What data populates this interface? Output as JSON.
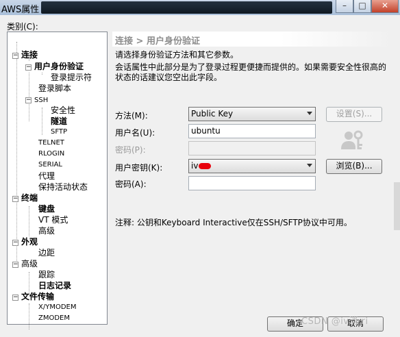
{
  "window": {
    "title": "AWS属性",
    "min_label": "–",
    "max_label": "□",
    "close_label": "✕"
  },
  "category_label": "类别(C):",
  "tree": {
    "items": [
      {
        "label": "连接",
        "bold": true,
        "expander": "−"
      },
      {
        "label": "用户身份验证",
        "bold": true,
        "expander": "−"
      },
      {
        "label": "登录提示符"
      },
      {
        "label": "登录脚本"
      },
      {
        "label": "SSH",
        "expander": "−"
      },
      {
        "label": "安全性"
      },
      {
        "label": "隧道",
        "bold": true
      },
      {
        "label": "SFTP"
      },
      {
        "label": "TELNET"
      },
      {
        "label": "RLOGIN"
      },
      {
        "label": "SERIAL"
      },
      {
        "label": "代理"
      },
      {
        "label": "保持活动状态"
      },
      {
        "label": "终端",
        "bold": true,
        "expander": "−"
      },
      {
        "label": "键盘",
        "bold": true
      },
      {
        "label": "VT 模式"
      },
      {
        "label": "高级"
      },
      {
        "label": "外观",
        "bold": true,
        "expander": "−"
      },
      {
        "label": "边距"
      },
      {
        "label": "高级",
        "expander": "−"
      },
      {
        "label": "跟踪"
      },
      {
        "label": "日志记录",
        "bold": true
      },
      {
        "label": "文件传输",
        "bold": true,
        "expander": "−"
      },
      {
        "label": "X/YMODEM"
      },
      {
        "label": "ZMODEM"
      }
    ]
  },
  "panel": {
    "breadcrumb": "连接 > 用户身份验证",
    "description": "请选择身份验证方法和其它参数。",
    "description2": "会话属性中此部分是为了登录过程更便捷而提供的。如果需要安全性很高的状态的话建议您空出此字段。"
  },
  "form": {
    "method_label": "方法(M):",
    "method_value": "Public Key",
    "settings_button": "设置(S)...",
    "username_label": "用户名(U):",
    "username_value": "ubuntu",
    "password_label": "密码(P):",
    "userkey_label": "用户密钥(K):",
    "userkey_value": "iv",
    "browse_button": "浏览(B)...",
    "passphrase_label": "密码(A):"
  },
  "note": "注释: 公钥和Keyboard Interactive仅在SSH/SFTP协议中可用。",
  "footer": {
    "ok_button": "确定",
    "cancel_button": "取消",
    "watermark": "CSDN @iv消 ri"
  }
}
